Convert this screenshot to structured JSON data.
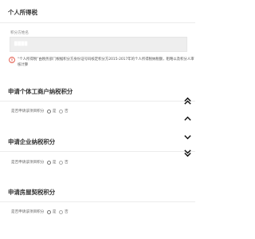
{
  "personal_tax": {
    "title": "个人所得税",
    "name_label": "积分方姓名",
    "name_value": "████",
    "notice": "“个人所得税”由税务部门根据积分方身份证号码核定积分方2015-2017年的个人所得税纳税额，粗略以及积分人审核计算"
  },
  "sections": [
    {
      "title": "申请个体工商户纳税积分",
      "question": "是否申请该项目积分",
      "yes": "是",
      "no": "否"
    },
    {
      "title": "申请企业纳税积分",
      "question": "是否申请该项目积分",
      "yes": "是",
      "no": "否"
    },
    {
      "title": "申请房屋契税积分",
      "question": "是否申请该项目积分",
      "yes": "是",
      "no": "否"
    }
  ],
  "colors": {
    "warning": "#e0412f",
    "input_bg": "#eeeeee",
    "divider": "#ececec"
  },
  "icons": {
    "warning": "exclamation-circle-icon",
    "scroll_top": "double-chevron-up-icon",
    "scroll_up": "chevron-up-icon",
    "scroll_down": "chevron-down-icon",
    "scroll_bottom": "double-chevron-down-icon"
  }
}
